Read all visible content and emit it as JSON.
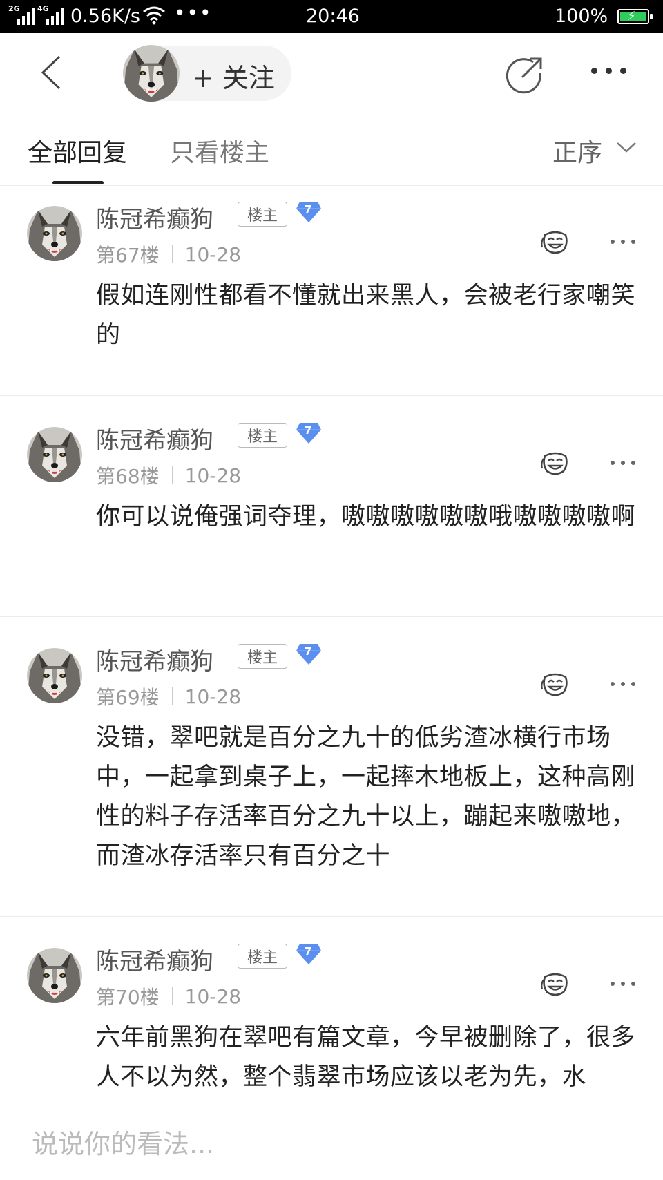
{
  "status_bar": {
    "network1": "2G",
    "network2": "4G",
    "speed": "0.56K/s",
    "dots": "•••",
    "time": "20:46",
    "battery_pct": "100%"
  },
  "header": {
    "follow_label": "+ 关注"
  },
  "tabs": {
    "all_replies": "全部回复",
    "only_op": "只看楼主",
    "sort": "正序"
  },
  "posts": [
    {
      "username": "陈冠希癫狗",
      "op_badge": "楼主",
      "level": "7",
      "floor": "第67楼",
      "date": "10-28",
      "content": "假如连刚性都看不懂就出来黑人，会被老行家嘲笑的"
    },
    {
      "username": "陈冠希癫狗",
      "op_badge": "楼主",
      "level": "7",
      "floor": "第68楼",
      "date": "10-28",
      "content": "你可以说俺强词夺理，嗷嗷嗷嗷嗷嗷哦嗷嗷嗷嗷啊"
    },
    {
      "username": "陈冠希癫狗",
      "op_badge": "楼主",
      "level": "7",
      "floor": "第69楼",
      "date": "10-28",
      "content": "没错，翠吧就是百分之九十的低劣渣冰横行市场中，一起拿到桌子上，一起摔木地板上，这种高刚性的料子存活率百分之九十以上，蹦起来嗷嗷地，而渣冰存活率只有百分之十"
    },
    {
      "username": "陈冠希癫狗",
      "op_badge": "楼主",
      "level": "7",
      "floor": "第70楼",
      "date": "10-28",
      "content": "六年前黑狗在翠吧有篇文章，今早被删除了，很多人不以为然，整个翡翠市场应该以老为先，水"
    }
  ],
  "bottom": {
    "comment_placeholder": "说说你的看法..."
  },
  "colors": {
    "level_badge": "#5a8ff0",
    "battery_fill": "#2ecc5b"
  }
}
